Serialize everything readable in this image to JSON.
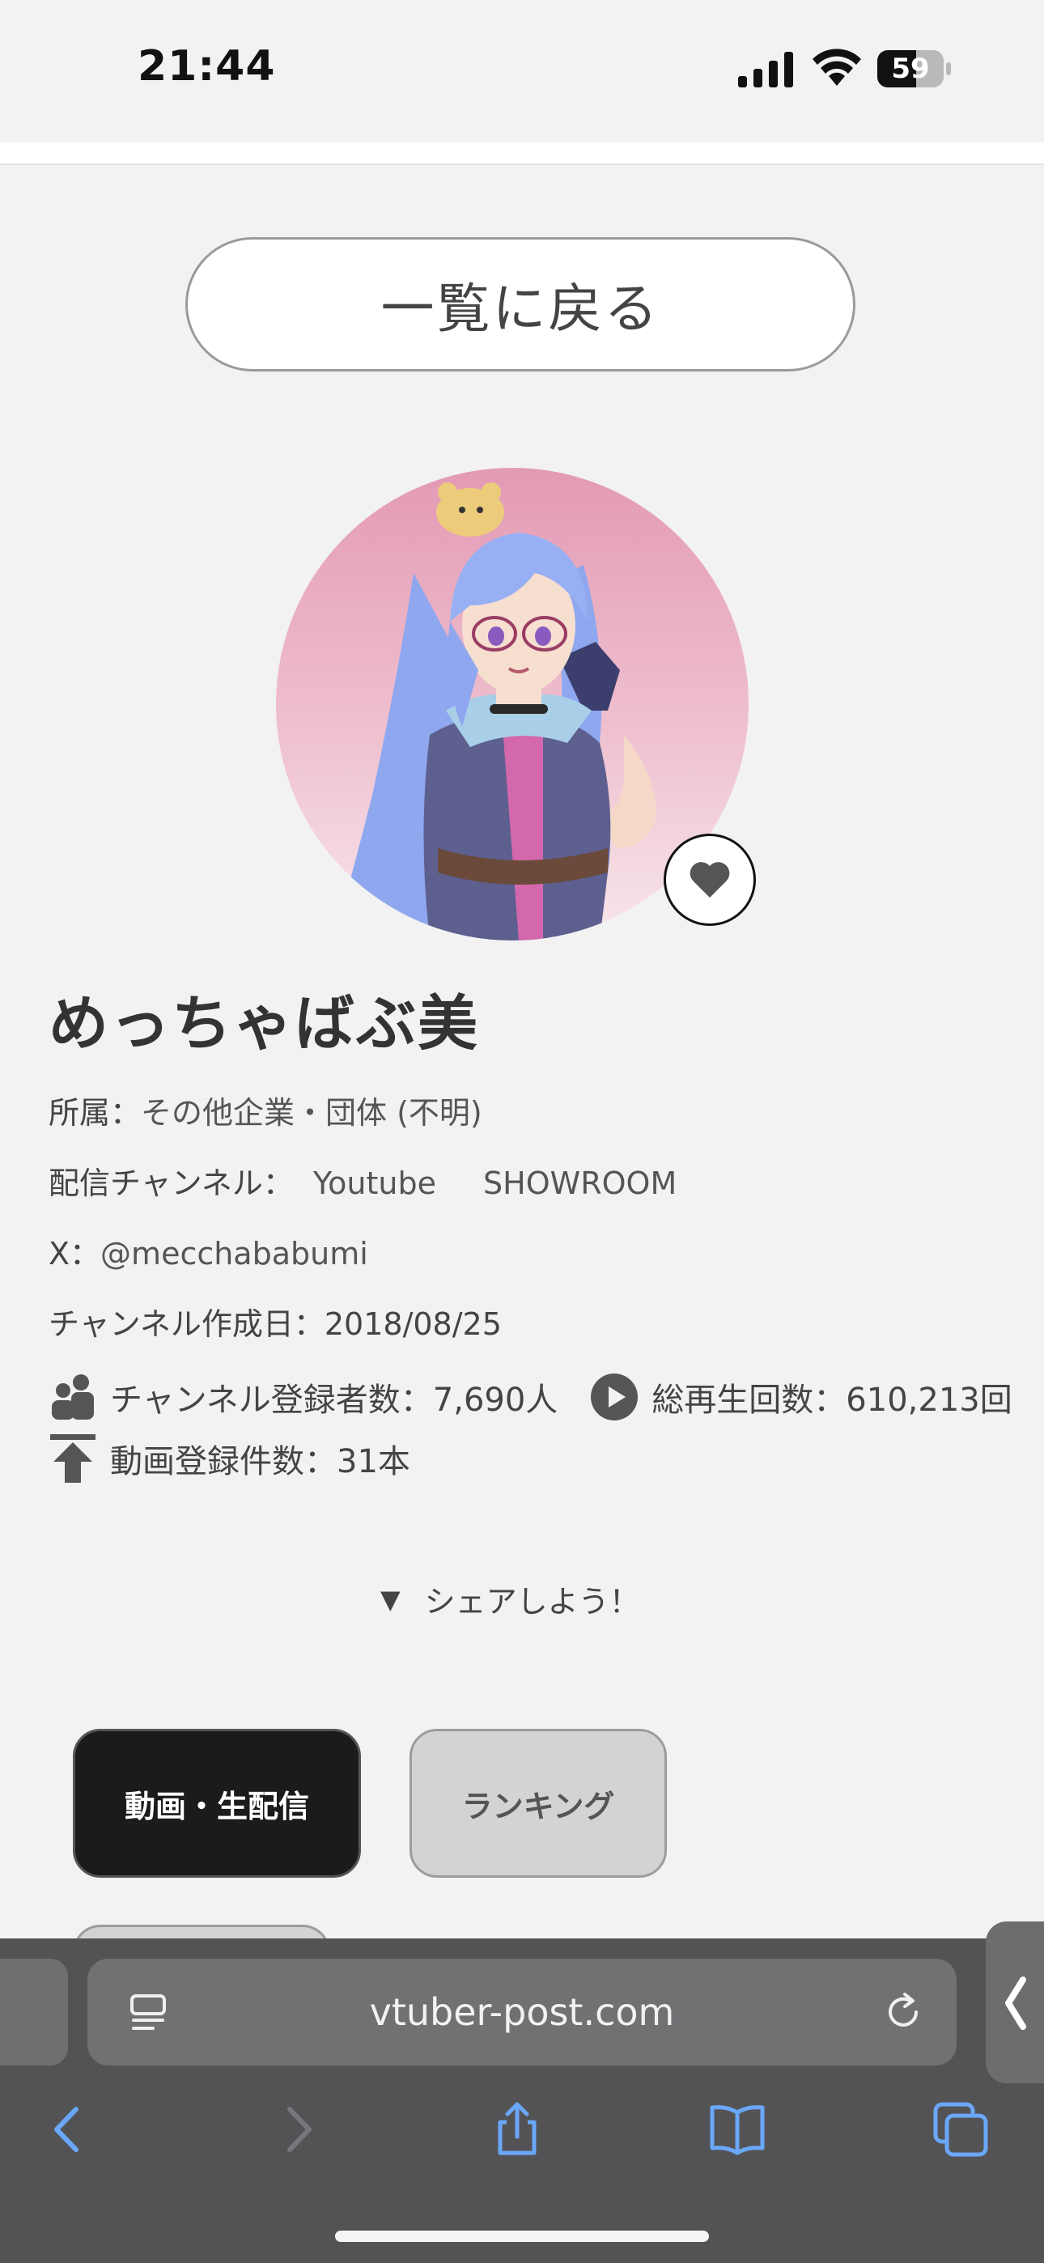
{
  "status_bar": {
    "time": "21:44",
    "battery": "59"
  },
  "back_button": {
    "label": "一覧に戻る"
  },
  "profile": {
    "name": "めっちゃばぶ美",
    "affiliation_label": "所属：",
    "affiliation_value": "その他企業・団体 (不明)",
    "channel_label": "配信チャンネル：",
    "channel_youtube": "Youtube",
    "channel_showroom": "SHOWROOM",
    "x_label": "X：",
    "x_handle": "@mecchababumi",
    "created_label": "チャンネル作成日：",
    "created_value": "2018/08/25"
  },
  "stats": {
    "subscribers": "チャンネル登録者数：7,690人",
    "total_views": "総再生回数：610,213回",
    "videos": "動画登録件数：31本"
  },
  "share": {
    "label": "シェアしよう！",
    "arrow": "▼"
  },
  "tabs": {
    "videos_live": "動画・生配信",
    "ranking": "ランキング"
  },
  "browser": {
    "url": "vtuber-post.com"
  },
  "colors": {
    "page_bg": "#f2f2f2",
    "active_tab_bg": "#1b1b1b",
    "inactive_tab_bg": "#d3d3d6",
    "toolbar_bg": "#535356",
    "toolbar_icon": "#6aa7f8"
  },
  "icons": {
    "reader": "reader-mode-icon",
    "reload": "reload-icon",
    "back": "back-arrow-icon",
    "forward": "forward-arrow-icon",
    "share": "share-icon",
    "bookmarks": "bookmarks-icon",
    "tabs": "tabs-icon",
    "favorite": "heart-icon",
    "subscribers": "people-icon",
    "views": "play-icon",
    "videos": "upload-icon"
  }
}
